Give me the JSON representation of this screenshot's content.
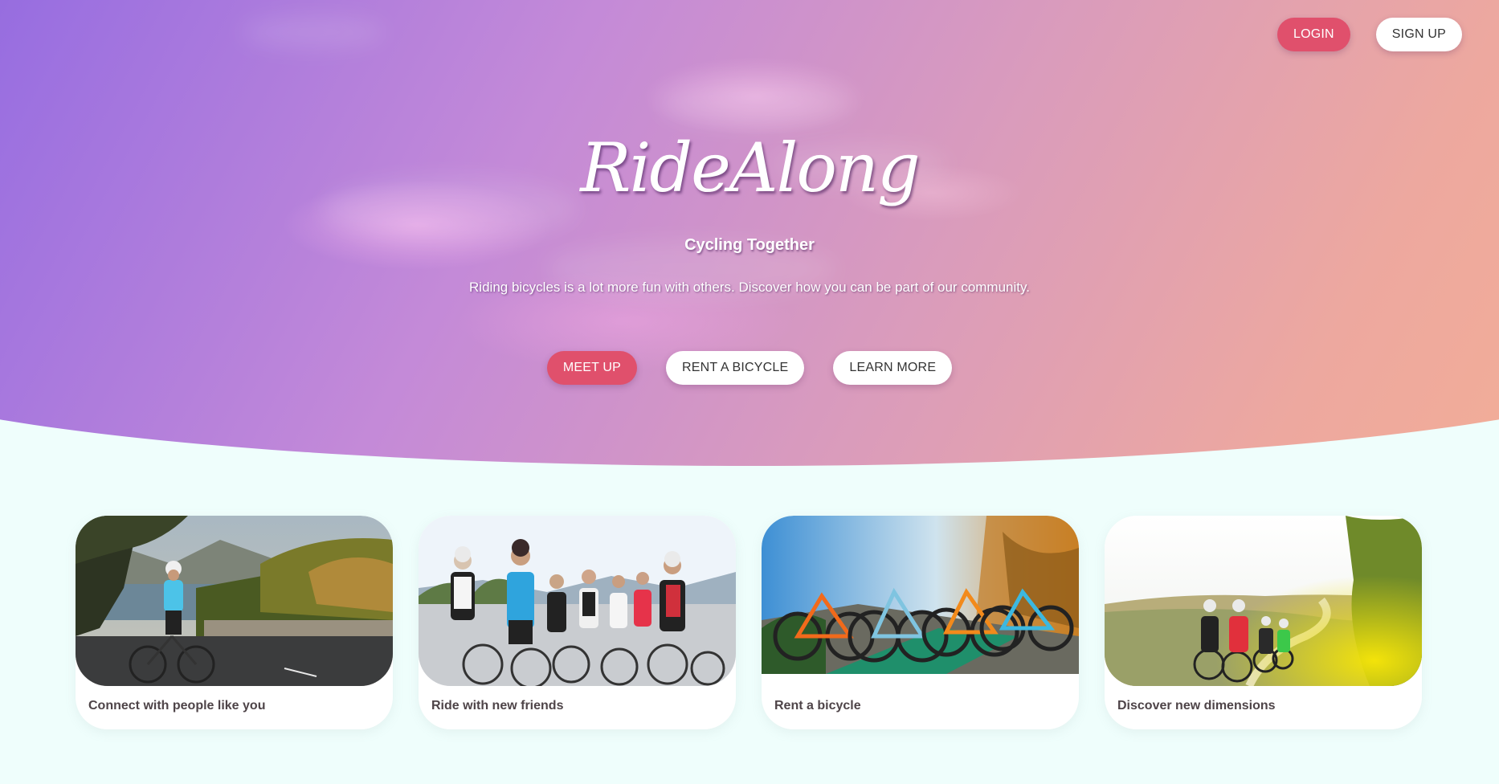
{
  "header": {
    "login_label": "LOGIN",
    "signup_label": "SIGN UP"
  },
  "hero": {
    "brand": "RideAlong",
    "tagline": "Cycling Together",
    "description": "Riding bicycles is a lot more fun with others. Discover how you can be part of our community.",
    "buttons": {
      "meet_up": "MEET UP",
      "rent": "RENT A BICYCLE",
      "learn": "LEARN MORE"
    }
  },
  "cards": [
    {
      "label": "Connect with people like you",
      "image": "cyclist-on-coastal-road-photo"
    },
    {
      "label": "Ride with new friends",
      "image": "group-of-cyclists-photo"
    },
    {
      "label": "Rent a bicycle",
      "image": "row-of-bicycles-photo"
    },
    {
      "label": "Discover new dimensions",
      "image": "cyclists-on-country-road-photo"
    }
  ],
  "colors": {
    "primary_button": "#e0506c",
    "secondary_button": "#ffffff",
    "page_background": "#effefc",
    "hero_gradient_start": "#7a58d8",
    "hero_gradient_end": "#f5b093"
  }
}
